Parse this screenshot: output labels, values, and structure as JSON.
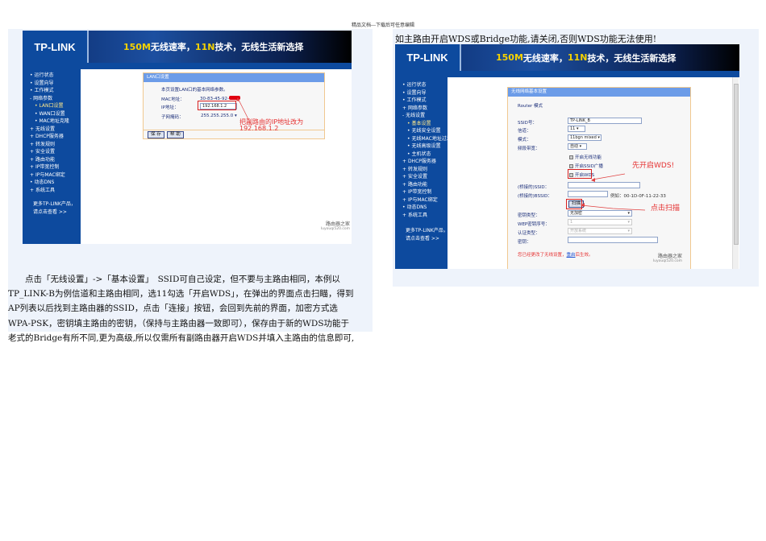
{
  "header_note": "精品文档---下载后可任意编辑",
  "right_caption": "如主路由开启WDS或Bridge功能,请关闭,否则WDS功能无法使用!",
  "paragraph": [
    "　　点击「无线设置」->「基本设置」　SSID可自己设定，但不要与主路由相同，本例以",
    "TP_LINK-B为例信道和主路由相同，选11勾选「开启WDS」，在弹出的界面点击扫瞄，得到",
    "AP列表以后找到主路由器的SSID，点击「连接」按钮，会回到先前的界面，加密方式选",
    "WPA-PSK，密钥填主路由的密钥，（保持与主路由器一致即可），保存由于新的WDS功能于",
    "老式的Bridge有所不同,更为高级,所以仅需所有副路由器开启WDS并填入主路由的信息即可,"
  ],
  "banner": {
    "logo": "TP-LINK",
    "slogan_a": "150M",
    "slogan_b": "无线速率，",
    "slogan_c": "11N",
    "slogan_d": "技术，无线生活新选择"
  },
  "watermark": {
    "name": "路由器之家",
    "url": "luyouqi520.com"
  },
  "left_shot": {
    "menu": [
      "运行状态",
      "设置向导",
      "工作模式",
      "网络参数",
      "LAN口设置",
      "WAN口设置",
      "MAC地址克隆",
      "无线设置",
      "DHCP服务器",
      "转发规则",
      "安全设置",
      "路由功能",
      "IP带宽控制",
      "IP与MAC绑定",
      "动态DNS",
      "系统工具"
    ],
    "more1": "更多TP-LINK产品，",
    "more2": "请点击查看 >>",
    "form_title": "LAN口设置",
    "intro": "本页设置LAN口的基本网络参数。",
    "mac_label": "MAC地址：",
    "mac_value": "30-83-45-92-",
    "ip_label": "IP地址：",
    "ip_value": "192.168.1.2",
    "mask_label": "子网掩码：",
    "mask_value": "255.255.255.0",
    "save": "保 存",
    "help": "帮 助",
    "annot1": "把副路由的IP地址改为",
    "annot2": "192.168.1.2"
  },
  "right_shot": {
    "menu": [
      "运行状态",
      "设置向导",
      "工作模式",
      "网络参数",
      "无线设置",
      "基本设置",
      "无线安全设置",
      "无线MAC地址过滤",
      "无线高级设置",
      "主机状态",
      "DHCP服务器",
      "转发规则",
      "安全设置",
      "路由功能",
      "IP带宽控制",
      "IP与MAC绑定",
      "动态DNS",
      "系统工具"
    ],
    "more1": "更多TP-LINK产品，",
    "more2": "请点击查看 >>",
    "form_title": "无线网络基本设置",
    "mode": "Router 模式",
    "ssid_label": "SSID号：",
    "ssid_value": "TP-LINK_B",
    "channel_label": "信道：",
    "channel_value": "11",
    "mode_label": "模式：",
    "mode_value": "11bgn mixed",
    "bw_label": "频段带宽：",
    "bw_value": "自动",
    "cb1": "开启无线功能",
    "cb2": "开启SSID广播",
    "cb3": "开启WDS",
    "bridged_ssid_label": "(桥接的)SSID：",
    "bridged_bssid_label": "(桥接的)BSSID：",
    "example": "例如：00-1D-0F-11-22-33",
    "scan": "扫描",
    "key_type_label": "密钥类型：",
    "key_type_value": "无加密",
    "wep_index_label": "WEP密钥序号：",
    "wep_index_value": "1",
    "auth_label": "认证类型：",
    "auth_value": "开放系统",
    "key_label": "密钥：",
    "notice_a": "您已经更改了无线设置，",
    "notice_link": "重启",
    "notice_b": "后生效。",
    "annot_wds": "先开启WDS!",
    "annot_scan": "点击扫描"
  }
}
